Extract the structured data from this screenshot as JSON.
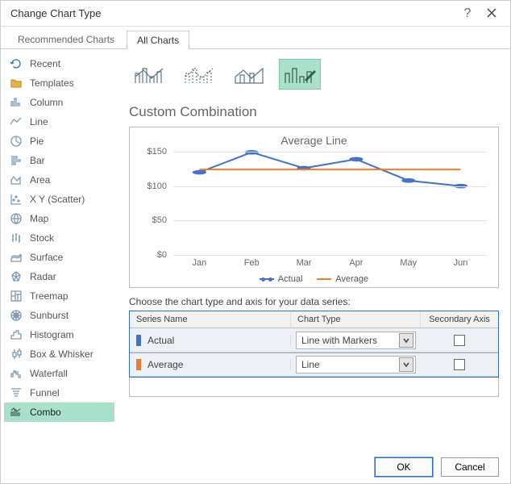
{
  "title": "Change Chart Type",
  "tabs": {
    "recommended": "Recommended Charts",
    "all": "All Charts",
    "active": "all"
  },
  "sidebar": {
    "items": [
      {
        "id": "recent",
        "label": "Recent"
      },
      {
        "id": "templates",
        "label": "Templates"
      },
      {
        "id": "column",
        "label": "Column"
      },
      {
        "id": "line",
        "label": "Line"
      },
      {
        "id": "pie",
        "label": "Pie"
      },
      {
        "id": "bar",
        "label": "Bar"
      },
      {
        "id": "area",
        "label": "Area"
      },
      {
        "id": "xy",
        "label": "X Y (Scatter)"
      },
      {
        "id": "map",
        "label": "Map"
      },
      {
        "id": "stock",
        "label": "Stock"
      },
      {
        "id": "surface",
        "label": "Surface"
      },
      {
        "id": "radar",
        "label": "Radar"
      },
      {
        "id": "treemap",
        "label": "Treemap"
      },
      {
        "id": "sunburst",
        "label": "Sunburst"
      },
      {
        "id": "histogram",
        "label": "Histogram"
      },
      {
        "id": "boxwhisker",
        "label": "Box & Whisker"
      },
      {
        "id": "waterfall",
        "label": "Waterfall"
      },
      {
        "id": "funnel",
        "label": "Funnel"
      },
      {
        "id": "combo",
        "label": "Combo"
      }
    ],
    "active": "combo"
  },
  "subtypes": {
    "active_index": 3
  },
  "section_title": "Custom Combination",
  "chart_data": {
    "type": "line",
    "title": "Average Line",
    "categories": [
      "Jan",
      "Feb",
      "Mar",
      "Apr",
      "May",
      "Jun"
    ],
    "ylim": [
      0,
      150
    ],
    "yticks": [
      0,
      50,
      100,
      150
    ],
    "yprefix": "$",
    "series": [
      {
        "name": "Actual",
        "color": "#4472c4",
        "markers": true,
        "values": [
          120,
          149,
          126,
          139,
          108,
          100
        ]
      },
      {
        "name": "Average",
        "color": "#ed7d31",
        "markers": false,
        "values": [
          124,
          124,
          124,
          124,
          124,
          124
        ]
      }
    ]
  },
  "series_panel": {
    "label": "Choose the chart type and axis for your data series:",
    "headers": {
      "name": "Series Name",
      "type": "Chart Type",
      "axis": "Secondary Axis"
    },
    "rows": [
      {
        "swatch": "#4472c4",
        "name": "Actual",
        "chart_type": "Line with Markers",
        "secondary": false
      },
      {
        "swatch": "#ed7d31",
        "name": "Average",
        "chart_type": "Line",
        "secondary": false
      }
    ]
  },
  "buttons": {
    "ok": "OK",
    "cancel": "Cancel"
  }
}
